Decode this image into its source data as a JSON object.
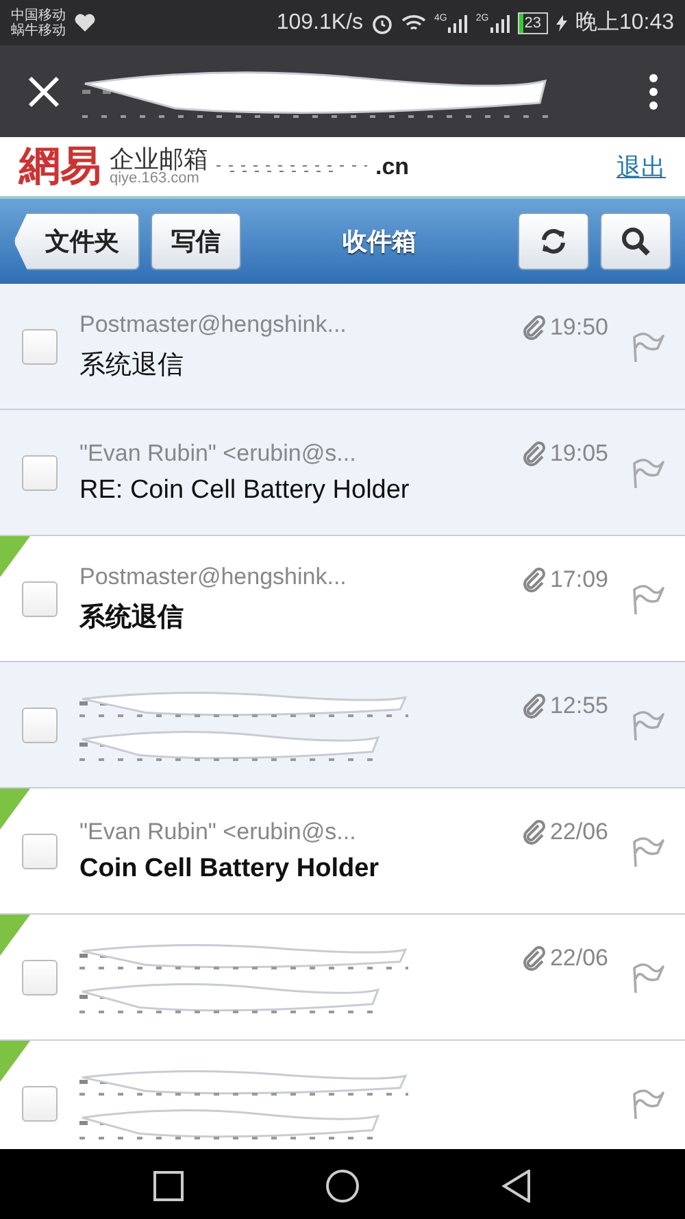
{
  "status_bar": {
    "carriers": [
      "中国移动",
      "蜗牛移动"
    ],
    "speed": "109.1K/s",
    "network_labels": [
      "4G",
      "2G"
    ],
    "battery": "23",
    "time": "晚上10:43"
  },
  "title_bar": {
    "redacted": true
  },
  "header": {
    "logo": "網易",
    "product": "企业邮箱",
    "domain": "qiye.163.com",
    "account": ".cn",
    "logout": "退出"
  },
  "toolbar": {
    "folders_button": "文件夹",
    "compose_button": "写信",
    "title": "收件箱"
  },
  "messages": [
    {
      "sender": "Postmaster@hengshink...",
      "subject": "系统退信",
      "time": "19:50",
      "unread": false,
      "attachment": true,
      "redacted": false
    },
    {
      "sender": "\"Evan Rubin\" <erubin@s...",
      "subject": "RE: Coin Cell Battery Holder",
      "time": "19:05",
      "unread": false,
      "attachment": true,
      "redacted": false
    },
    {
      "sender": "Postmaster@hengshink...",
      "subject": "系统退信",
      "time": "17:09",
      "unread": true,
      "attachment": true,
      "redacted": false
    },
    {
      "time": "12:55",
      "unread": false,
      "attachment": true,
      "redacted": true
    },
    {
      "sender": "\"Evan Rubin\" <erubin@s...",
      "subject": "Coin Cell Battery Holder",
      "time": "22/06",
      "unread": true,
      "attachment": true,
      "redacted": false
    },
    {
      "time": "22/06",
      "unread": true,
      "attachment": true,
      "redacted": true
    },
    {
      "unread": true,
      "attachment": false,
      "redacted": true
    }
  ]
}
